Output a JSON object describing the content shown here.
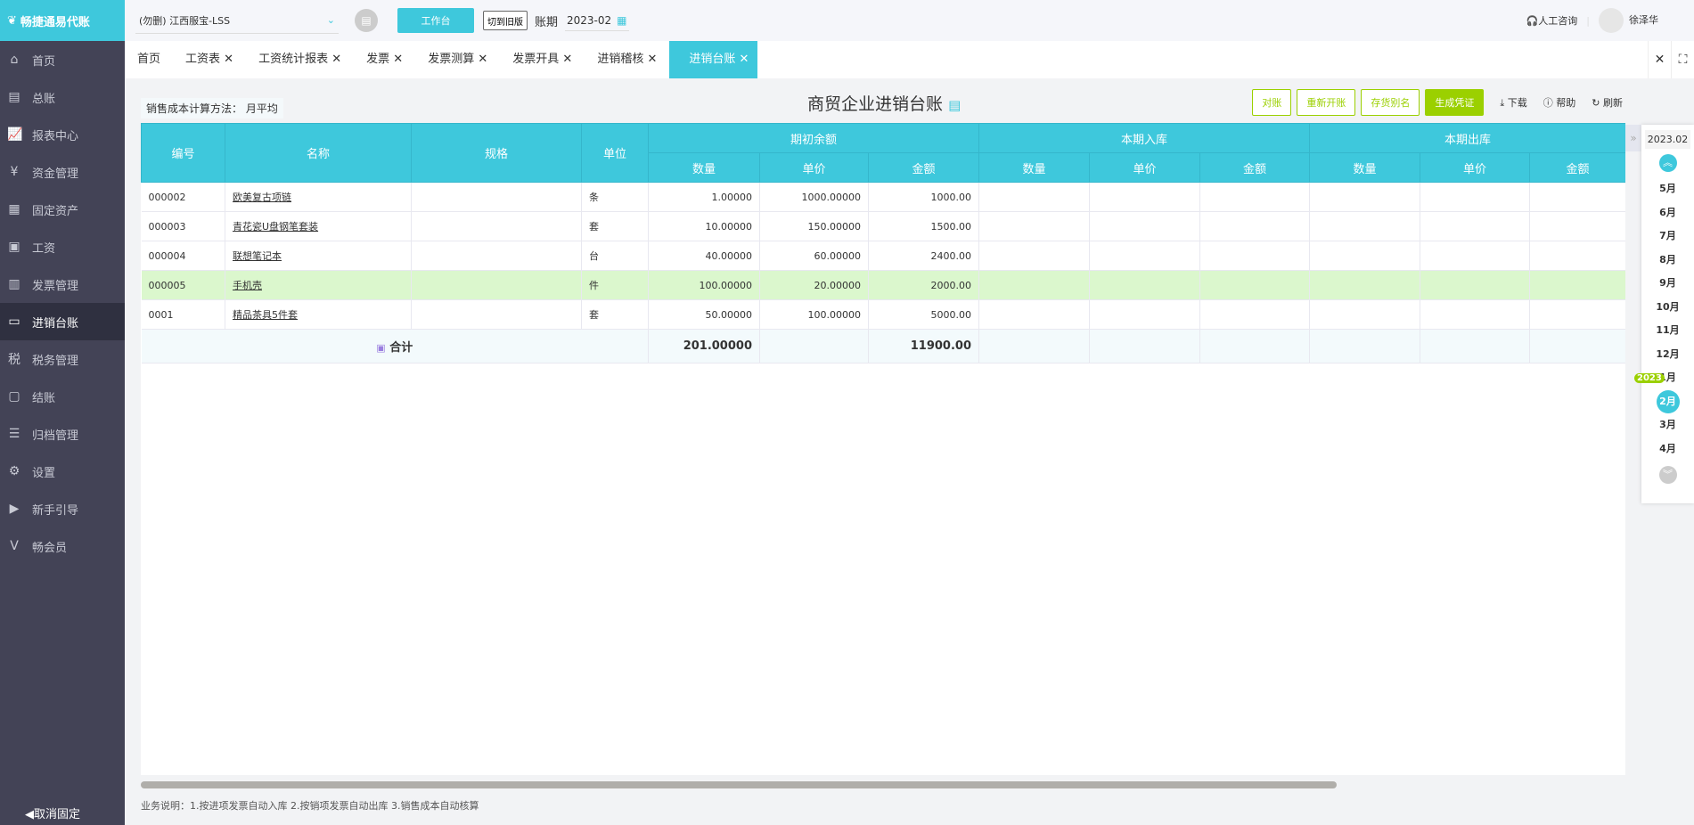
{
  "app": {
    "logo": "畅捷通易代账",
    "unpin": "取消固定"
  },
  "sidebar": {
    "items": [
      {
        "label": "首页",
        "icon": "⌂"
      },
      {
        "label": "总账",
        "icon": "▤"
      },
      {
        "label": "报表中心",
        "icon": "📈"
      },
      {
        "label": "资金管理",
        "icon": "¥"
      },
      {
        "label": "固定资产",
        "icon": "▦"
      },
      {
        "label": "工资",
        "icon": "▣"
      },
      {
        "label": "发票管理",
        "icon": "▥"
      },
      {
        "label": "进销台账",
        "icon": "▭"
      },
      {
        "label": "税务管理",
        "icon": "税"
      },
      {
        "label": "结账",
        "icon": "▢"
      },
      {
        "label": "归档管理",
        "icon": "☰"
      },
      {
        "label": "设置",
        "icon": "⚙"
      },
      {
        "label": "新手引导",
        "icon": "▶"
      },
      {
        "label": "畅会员",
        "icon": "V"
      }
    ],
    "active": 7
  },
  "topbar": {
    "company": "(勿删) 江西服宝-LSS",
    "workbench": "工作台",
    "switch_old": "切到旧版",
    "period_label": "账期",
    "period": "2023-02",
    "consult": "人工咨询",
    "user": "徐泽华"
  },
  "tabs": [
    "首页",
    "工资表",
    "工资统计报表",
    "发票",
    "发票测算",
    "发票开具",
    "进销稽核",
    "进销台账"
  ],
  "toolbar": {
    "method_label": "销售成本计算方法：",
    "method": "月平均",
    "title": "商贸企业进销台账",
    "reconcile": "对账",
    "reopen": "重新开账",
    "alias": "存货别名",
    "voucher": "生成凭证",
    "download": "下载",
    "help": "帮助",
    "refresh": "刷新"
  },
  "table": {
    "headers": {
      "code": "编号",
      "name": "名称",
      "spec": "规格",
      "unit": "单位",
      "opening": "期初余额",
      "in": "本期入库",
      "out": "本期出库",
      "qty": "数量",
      "price": "单价",
      "amount": "金额"
    },
    "rows": [
      {
        "code": "000002",
        "name": "欧美复古项链",
        "spec": "",
        "unit": "条",
        "qty": "1.00000",
        "price": "1000.00000",
        "amount": "1000.00"
      },
      {
        "code": "000003",
        "name": "青花瓷U盘钢笔套装",
        "spec": "",
        "unit": "套",
        "qty": "10.00000",
        "price": "150.00000",
        "amount": "1500.00"
      },
      {
        "code": "000004",
        "name": "联想笔记本",
        "spec": "",
        "unit": "台",
        "qty": "40.00000",
        "price": "60.00000",
        "amount": "2400.00"
      },
      {
        "code": "000005",
        "name": "手机壳",
        "spec": "",
        "unit": "件",
        "qty": "100.00000",
        "price": "20.00000",
        "amount": "2000.00"
      },
      {
        "code": "0001",
        "name": "精品茶具5件套",
        "spec": "",
        "unit": "套",
        "qty": "50.00000",
        "price": "100.00000",
        "amount": "5000.00"
      }
    ],
    "highlight_row": 3,
    "total": {
      "label": "合计",
      "qty": "201.00000",
      "amount": "11900.00"
    }
  },
  "footer_note": "业务说明：1.按进项发票自动入库   2.按销项发票自动出库   3.销售成本自动核算",
  "datepanel": {
    "current": "2023.02",
    "year_badge": "2023",
    "months": [
      "5月",
      "6月",
      "7月",
      "8月",
      "9月",
      "10月",
      "11月",
      "12月",
      "1月",
      "2月",
      "3月",
      "4月"
    ],
    "selected": "2月"
  },
  "colors": {
    "accent": "#3ec8dc",
    "green": "#9bd000",
    "sidebar": "#434356"
  }
}
